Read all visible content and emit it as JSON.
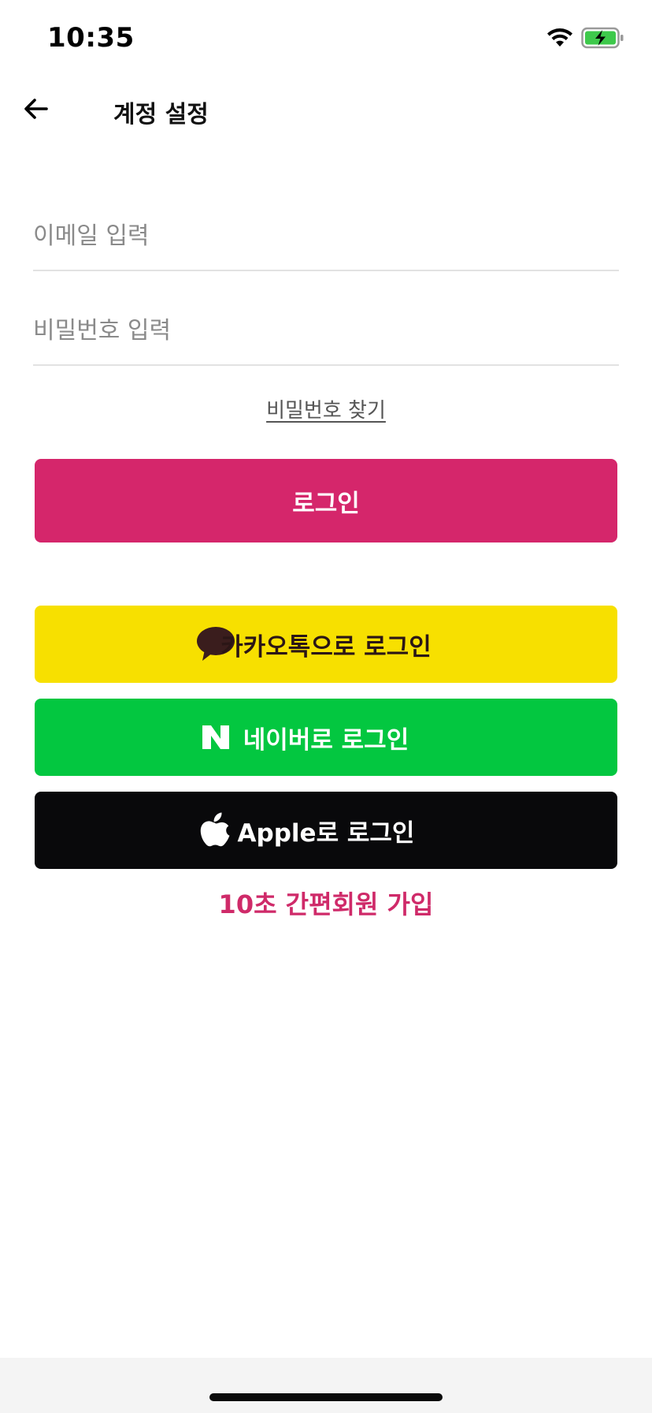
{
  "status_bar": {
    "time": "10:35",
    "icons": [
      "wifi-icon",
      "battery-charging-icon"
    ],
    "battery_color": "#3ec94b"
  },
  "nav": {
    "back_icon": "arrow-left-icon",
    "title": "계정 설정"
  },
  "form": {
    "email_placeholder": "이메일 입력",
    "email_value": "",
    "password_placeholder": "비밀번호 입력",
    "password_value": "",
    "find_password_label": "비밀번호 찾기"
  },
  "buttons": {
    "login_label": "로그인",
    "login_color": "#d5266b",
    "kakao_label": "카카오톡으로 로그인",
    "kakao_icon": "kakao-speech-bubble-icon",
    "kakao_color": "#f7e000",
    "naver_label": "네이버로 로그인",
    "naver_icon": "naver-n-icon",
    "naver_color": "#03c740",
    "apple_label": "Apple로 로그인",
    "apple_icon": "apple-logo-icon",
    "apple_color": "#09090b"
  },
  "signup": {
    "label": "10초 간편회원 가입",
    "color": "#cf2a69"
  }
}
